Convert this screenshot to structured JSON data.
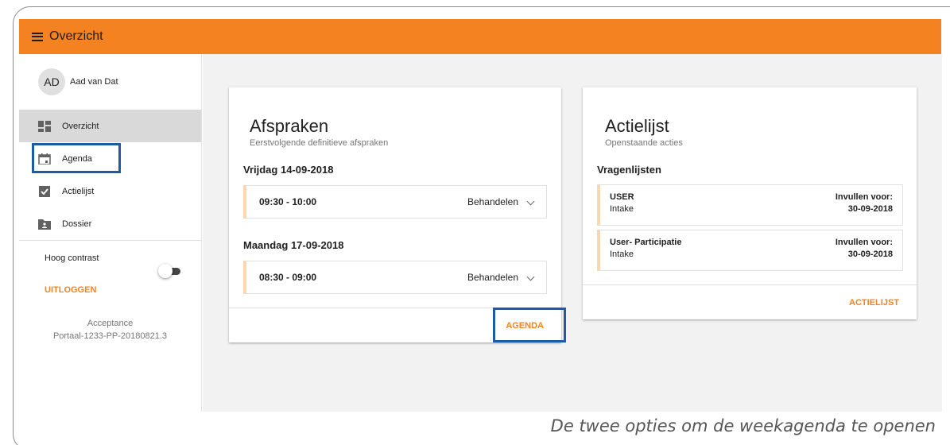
{
  "header": {
    "title": "Overzicht"
  },
  "user": {
    "initials": "AD",
    "name": "Aad van Dat"
  },
  "sidebar": {
    "items": [
      {
        "label": "Overzicht",
        "icon": "dashboard-icon"
      },
      {
        "label": "Agenda",
        "icon": "calendar-icon"
      },
      {
        "label": "Actielijst",
        "icon": "checkbox-icon"
      },
      {
        "label": "Dossier",
        "icon": "folder-icon"
      }
    ],
    "contrast_label": "Hoog contrast",
    "logout_label": "UITLOGGEN",
    "version_line1": "Acceptance",
    "version_line2": "Portaal-1233-PP-20180821.3"
  },
  "afspraken": {
    "title": "Afspraken",
    "subtitle": "Eerstvolgende definitieve afspraken",
    "days": [
      {
        "date": "Vrijdag 14-09-2018",
        "time": "09:30 - 10:00",
        "action": "Behandelen"
      },
      {
        "date": "Maandag 17-09-2018",
        "time": "08:30 - 09:00",
        "action": "Behandelen"
      }
    ],
    "footer_link": "AGENDA"
  },
  "actielijst": {
    "title": "Actielijst",
    "subtitle": "Openstaande acties",
    "section": "Vragenlijsten",
    "items": [
      {
        "name": "USER",
        "type": "Intake",
        "due_label": "Invullen voor:",
        "due_date": "30-09-2018"
      },
      {
        "name": "User- Participatie",
        "type": "Intake",
        "due_label": "Invullen voor:",
        "due_date": "30-09-2018"
      }
    ],
    "footer_link": "ACTIELIJST"
  },
  "caption": "De twee opties om de weekagenda te openen",
  "colors": {
    "accent": "#f58220",
    "highlight": "#1f5aa6",
    "appt_border": "#fbd7ae"
  }
}
